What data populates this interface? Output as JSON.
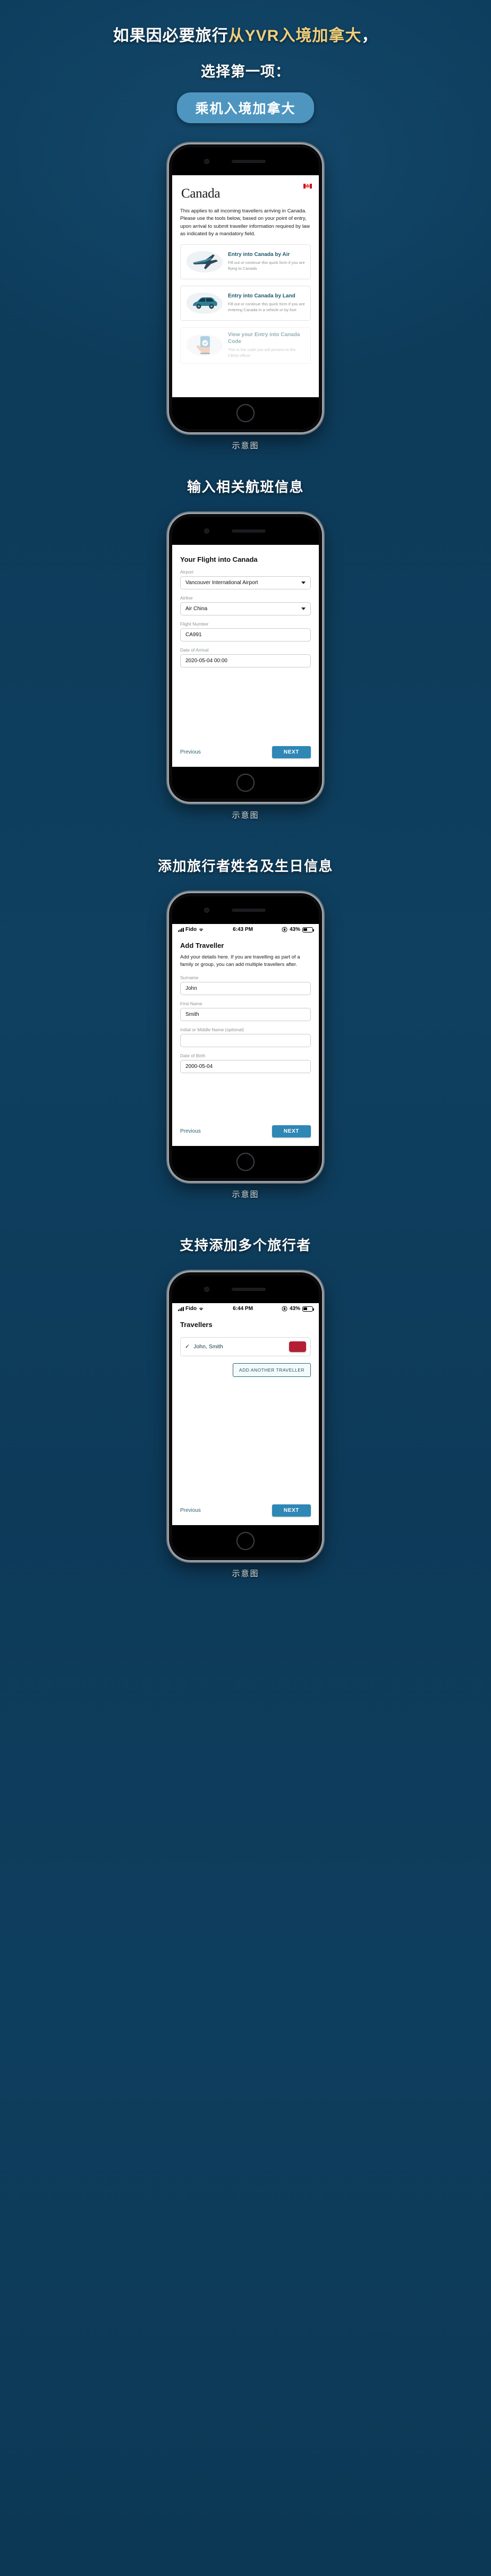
{
  "intro": {
    "line1_plain": "如果因必要旅行",
    "line1_highlight": "从YVR入境加拿大",
    "line1_tail": "，",
    "line2": "选择第一项：",
    "pill_label": "乘机入境加拿大",
    "highlight_color": "#f2cf7a",
    "pill_color": "#4e96c0"
  },
  "caption": "示意图",
  "background_color": "#0d3c5c",
  "sections": [
    {
      "heading": "",
      "screen": "canada-landing"
    },
    {
      "heading": "输入相关航班信息",
      "screen": "flight-form"
    },
    {
      "heading": "添加旅行者姓名及生日信息",
      "screen": "traveller-form"
    },
    {
      "heading": "支持添加多个旅行者",
      "screen": "travellers-list"
    }
  ],
  "screen1": {
    "logo_text": "Canada",
    "body_text": "This applies to all incoming travellers arriving in Canada. Please use the tools below, based on your point of entry, upon arrival to submit traveller information required by law as indicated by a mandatory field.",
    "options": [
      {
        "title": "Entry into Canada by Air",
        "subtitle": "Fill out or continue this quick form if you are flying to Canada",
        "icon": "airplane-icon",
        "muted": false
      },
      {
        "title": "Entry into Canada by Land",
        "subtitle": "Fill out or continue this quick form if you are entering Canada in a vehicle or by foot",
        "icon": "car-icon",
        "muted": false
      },
      {
        "title": "View your Entry into Canada Code",
        "subtitle": "This is the code you will present to the CBSA officer",
        "icon": "phone-in-hand-icon",
        "muted": true
      }
    ]
  },
  "screen2": {
    "title": "Your Flight into Canada",
    "fields": [
      {
        "label": "Airport",
        "value": "Vancouver International Airport",
        "type": "select"
      },
      {
        "label": "Airline",
        "value": "Air China",
        "type": "select"
      },
      {
        "label": "Flight Number",
        "value": "CA991",
        "type": "text"
      },
      {
        "label": "Date of Arrival",
        "value": "2020-05-04 00:00",
        "type": "text"
      }
    ],
    "previous_label": "Previous",
    "next_label": "NEXT"
  },
  "screen3": {
    "statusbar": {
      "carrier": "Fido",
      "time": "6:43 PM",
      "battery": "43%"
    },
    "title": "Add Traveller",
    "description": "Add your details here. If you are travelling as part of a family or group, you can add multiple travellers after.",
    "fields": [
      {
        "label": "Surname",
        "value": "John",
        "type": "text"
      },
      {
        "label": "First Name",
        "value": "Smith",
        "type": "text"
      },
      {
        "label": "Initial or Middle Name (optional)",
        "value": "",
        "type": "text"
      },
      {
        "label": "Date of Birth",
        "value": "2000-05-04",
        "type": "text"
      }
    ],
    "previous_label": "Previous",
    "next_label": "NEXT"
  },
  "screen4": {
    "statusbar": {
      "carrier": "Fido",
      "time": "6:44 PM",
      "battery": "43%"
    },
    "title": "Travellers",
    "traveller_name": "John, Smith",
    "check_glyph": "✓",
    "delete_color": "#b41f36",
    "add_label": "ADD ANOTHER TRAVELLER",
    "previous_label": "Previous",
    "next_label": "NEXT"
  }
}
